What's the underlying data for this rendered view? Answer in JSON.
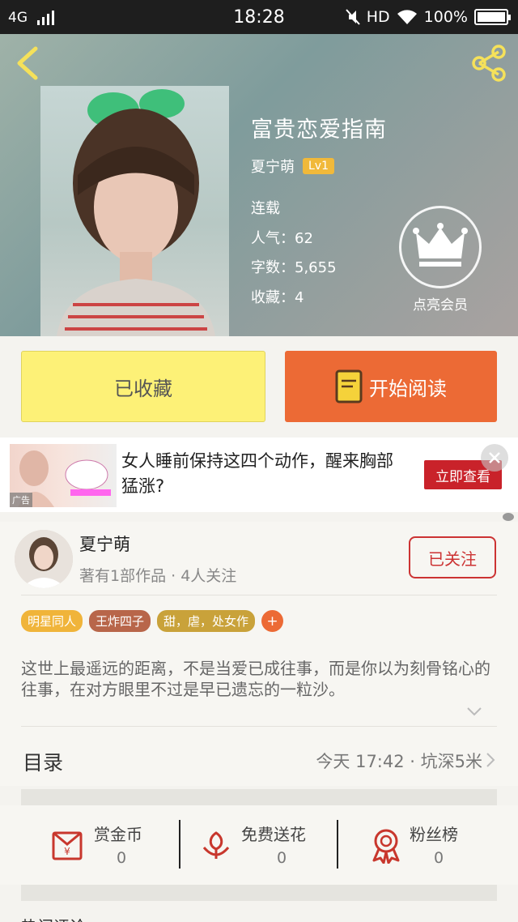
{
  "status_bar": {
    "network": "4G",
    "time": "18:28",
    "hd": "HD",
    "battery": "100%",
    "battery_level": 1.0
  },
  "book": {
    "title": "富贵恋爱指南",
    "author": "夏宁萌",
    "level": "Lv1",
    "status": "连载",
    "popularity": "人气：62",
    "word_count": "字数：5,655",
    "favorites": "收藏：4"
  },
  "vip": {
    "label": "点亮会员"
  },
  "actions": {
    "favorited_label": "已收藏",
    "read_label": "开始阅读"
  },
  "ad": {
    "text": "女人睡前保持这四个动作，醒来胸部猛涨?",
    "cta": "立即查看",
    "tag": "广告"
  },
  "author_card": {
    "name": "夏宁萌",
    "stats": "著有1部作品 · 4人关注",
    "follow_label": "已关注"
  },
  "tags": [
    {
      "label": "明星同人",
      "color": "#f0b43a"
    },
    {
      "label": "王炸四子",
      "color": "#b8664a"
    },
    {
      "label": "甜，虐，处女作",
      "color": "#c9a23a"
    },
    {
      "label": "+",
      "color": "#ec6a35"
    }
  ],
  "description": "这世上最遥远的距离，不是当爱已成往事，而是你以为刻骨铭心的往事，在对方眼里不过是早已遗忘的一粒沙。",
  "toc": {
    "label": "目录",
    "info": "今天 17:42 · 坑深5米"
  },
  "rewards": [
    {
      "label": "赏金币",
      "value": "0",
      "icon": "coin-envelope-icon"
    },
    {
      "label": "免费送花",
      "value": "0",
      "icon": "flower-icon"
    },
    {
      "label": "粉丝榜",
      "value": "0",
      "icon": "medal-icon"
    }
  ],
  "bottom_partial": "热门评论"
}
